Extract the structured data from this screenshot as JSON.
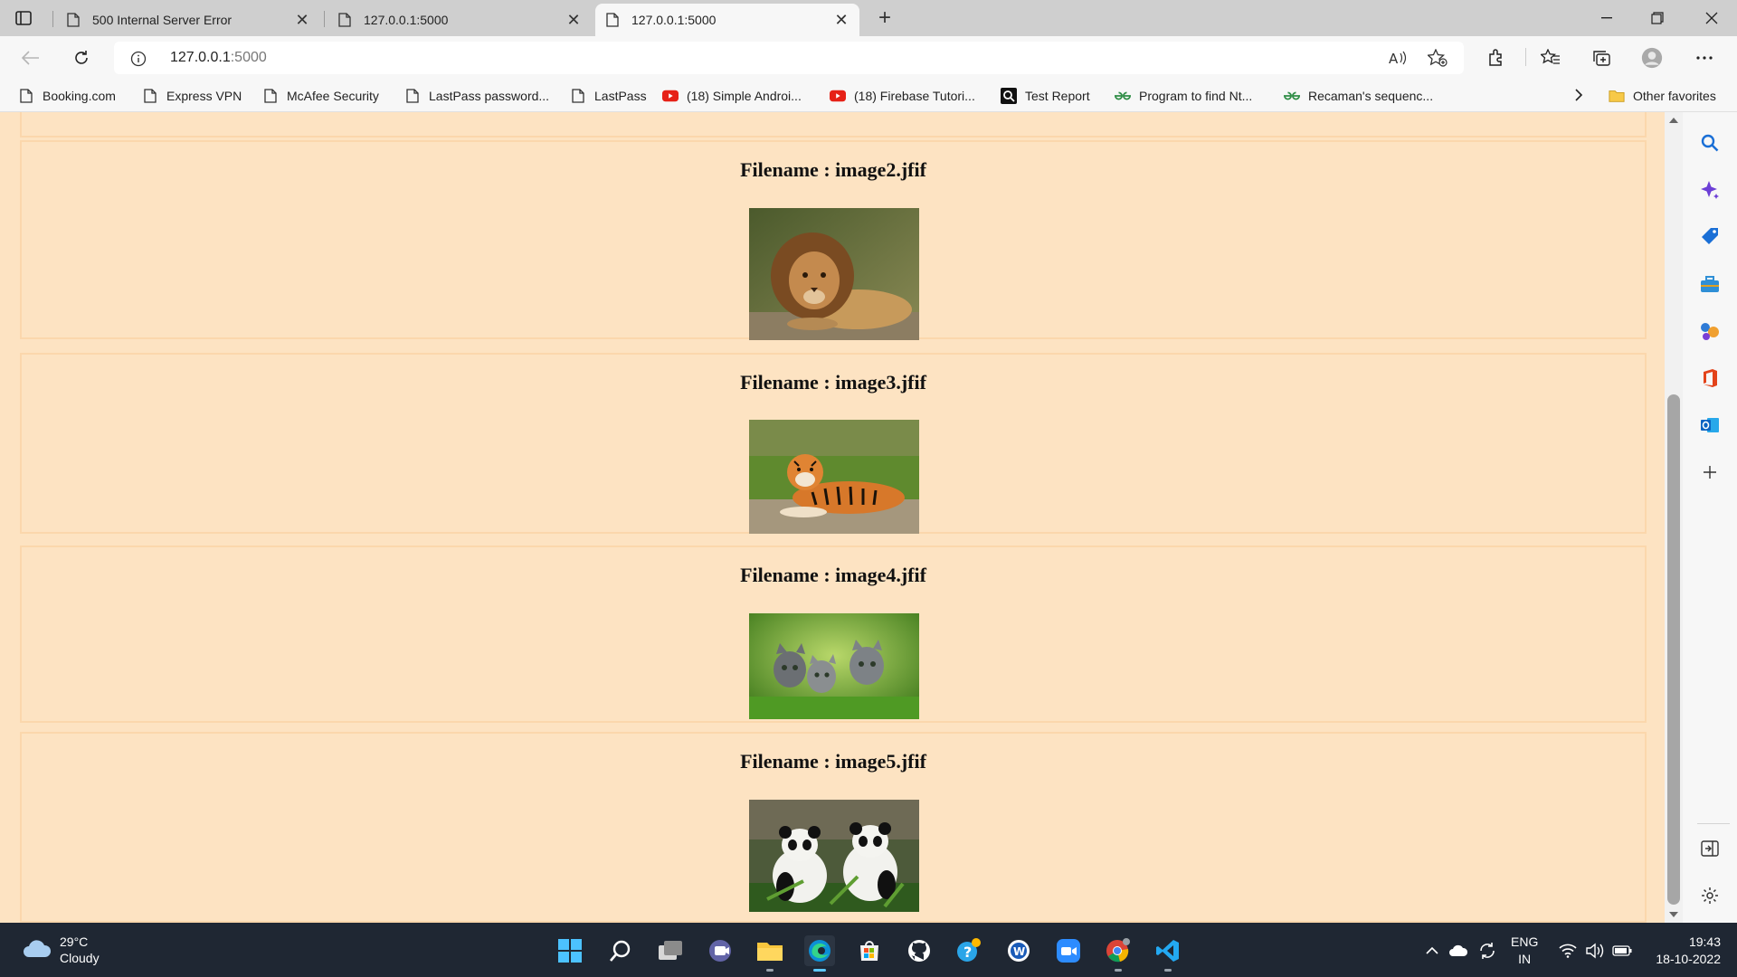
{
  "tabs": [
    {
      "title": "500 Internal Server Error",
      "active": false
    },
    {
      "title": "127.0.0.1:5000",
      "active": false
    },
    {
      "title": "127.0.0.1:5000",
      "active": true
    }
  ],
  "address": {
    "host": "127.0.0.1",
    "port": ":5000"
  },
  "bookmarks": [
    {
      "label": "Booking.com",
      "icon": "page-icon"
    },
    {
      "label": "Express VPN",
      "icon": "page-icon"
    },
    {
      "label": "McAfee Security",
      "icon": "page-icon"
    },
    {
      "label": "LastPass password...",
      "icon": "page-icon"
    },
    {
      "label": "LastPass",
      "icon": "page-icon"
    },
    {
      "label": "(18) Simple Androi...",
      "icon": "youtube-icon"
    },
    {
      "label": "(18) Firebase Tutori...",
      "icon": "youtube-icon"
    },
    {
      "label": "Test Report",
      "icon": "search-report-icon"
    },
    {
      "label": "Program to find Nt...",
      "icon": "gfg-icon"
    },
    {
      "label": "Recaman's sequenc...",
      "icon": "gfg-icon"
    }
  ],
  "other_favorites": "Other favorites",
  "gallery": [
    {
      "heading": "Filename : image2.jfif",
      "image": "lion"
    },
    {
      "heading": "Filename : image3.jfif",
      "image": "tiger"
    },
    {
      "heading": "Filename : image4.jfif",
      "image": "kittens"
    },
    {
      "heading": "Filename : image5.jfif",
      "image": "pandas"
    }
  ],
  "weather": {
    "temp": "29°C",
    "condition": "Cloudy"
  },
  "tray": {
    "lang1": "ENG",
    "lang2": "IN",
    "time": "19:43",
    "date": "18-10-2022"
  },
  "colors": {
    "page_bg": "#fde3c2",
    "card_border": "#fbd7ac",
    "taskbar": "#1f2733",
    "accent": "#0078d4"
  }
}
